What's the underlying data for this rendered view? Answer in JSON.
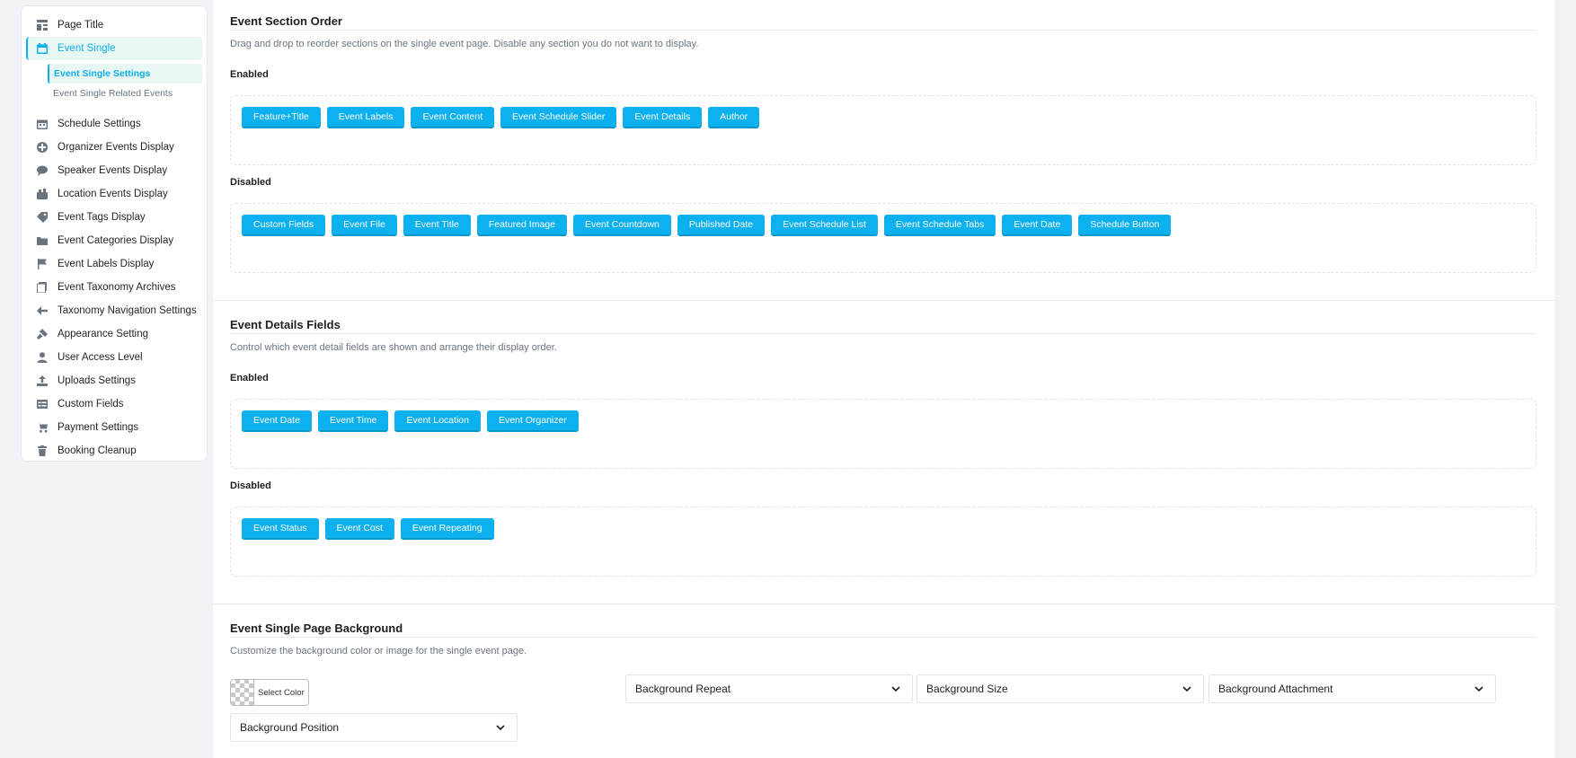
{
  "sidebar": {
    "items": [
      {
        "label": "Page Title",
        "icon": "page-title-icon"
      },
      {
        "label": "Event Single",
        "icon": "calendar-icon"
      },
      {
        "label": "Schedule Settings",
        "icon": "calendar-icon"
      },
      {
        "label": "Organizer Events Display",
        "icon": "organizer-icon"
      },
      {
        "label": "Speaker Events Display",
        "icon": "speech-bubble-icon"
      },
      {
        "label": "Location Events Display",
        "icon": "location-icon"
      },
      {
        "label": "Event Tags Display",
        "icon": "tag-icon"
      },
      {
        "label": "Event Categories Display",
        "icon": "folder-icon"
      },
      {
        "label": "Event Labels Display",
        "icon": "flag-icon"
      },
      {
        "label": "Event Taxonomy Archives",
        "icon": "archive-icon"
      },
      {
        "label": "Taxonomy Navigation Settings",
        "icon": "arrow-left-icon"
      },
      {
        "label": "Appearance Setting",
        "icon": "brush-icon"
      },
      {
        "label": "User Access Level",
        "icon": "user-icon"
      },
      {
        "label": "Uploads Settings",
        "icon": "upload-icon"
      },
      {
        "label": "Custom Fields",
        "icon": "fields-icon"
      },
      {
        "label": "Payment Settings",
        "icon": "cart-icon"
      },
      {
        "label": "Booking Cleanup",
        "icon": "trash-icon"
      }
    ],
    "sub_items": [
      {
        "label": "Event Single Settings",
        "active": true
      },
      {
        "label": "Event Single Related Events",
        "active": false
      }
    ]
  },
  "section_order": {
    "title": "Event Section Order",
    "description": "Drag and drop to reorder sections on the single event page. Disable any section you do not want to display.",
    "enabled_label": "Enabled",
    "enabled": [
      "Feature+Title",
      "Event Labels",
      "Event Content",
      "Event Schedule Slider",
      "Event Details",
      "Author"
    ],
    "disabled_label": "Disabled",
    "disabled": [
      "Custom Fields",
      "Event File",
      "Event Title",
      "Featured Image",
      "Event Countdown",
      "Published Date",
      "Event Schedule List",
      "Event Schedule Tabs",
      "Event Date",
      "Schedule Button"
    ]
  },
  "details_fields": {
    "title": "Event Details Fields",
    "description": "Control which event detail fields are shown and arrange their display order.",
    "enabled_label": "Enabled",
    "enabled": [
      "Event Date",
      "Event Time",
      "Event Location",
      "Event Organizer"
    ],
    "disabled_label": "Disabled",
    "disabled": [
      "Event Status",
      "Event Cost",
      "Event Repeating"
    ]
  },
  "background": {
    "title": "Event Single Page Background",
    "description": "Customize the background color or image for the single event page.",
    "select_color_label": "Select Color",
    "repeat": "Background Repeat",
    "size": "Background Size",
    "attachment": "Background Attachment",
    "position": "Background Position"
  },
  "colors": {
    "accent": "#0fb0ea",
    "chip": "#0eb1ef",
    "active_bg": "#e8f7f3"
  }
}
